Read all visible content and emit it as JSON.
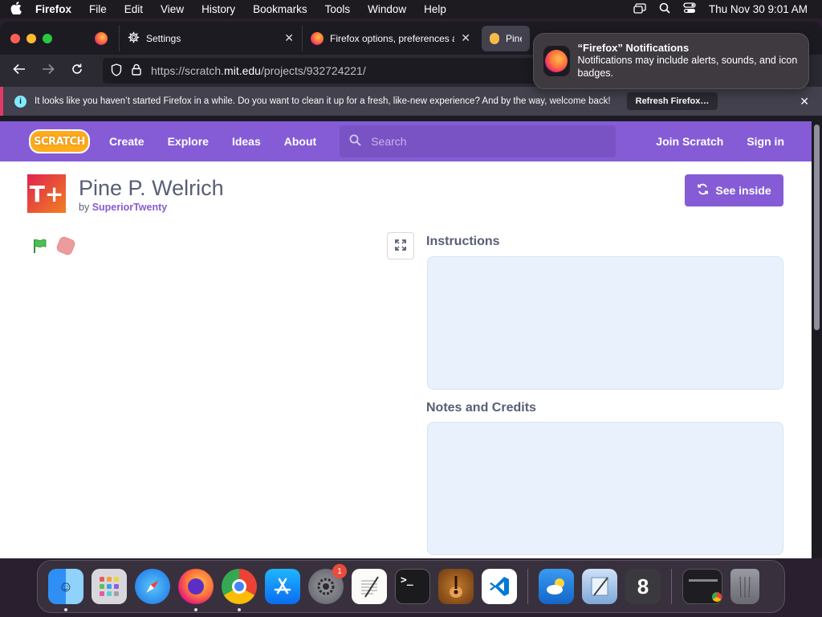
{
  "menubar": {
    "app_name": "Firefox",
    "menus": [
      "File",
      "Edit",
      "View",
      "History",
      "Bookmarks",
      "Tools",
      "Window",
      "Help"
    ],
    "clock": "Thu Nov 30  9:01 AM"
  },
  "tabs": {
    "settings": {
      "label": "Settings"
    },
    "options": {
      "label": "Firefox options, preferences and"
    },
    "active": {
      "label": "Pine P"
    }
  },
  "urlbar": {
    "prefix": "https://scratch.",
    "domain": "mit.edu",
    "path": "/projects/932724221/"
  },
  "infobar": {
    "message": "It looks like you haven’t started Firefox in a while. Do you want to clean it up for a fresh, like-new experience? And by the way, welcome back!",
    "button": "Refresh Firefox…"
  },
  "notification": {
    "title": "“Firefox” Notifications",
    "body": "Notifications may include alerts, sounds, and icon badges."
  },
  "scratch_nav": {
    "logo": "SCRATCH",
    "links": [
      "Create",
      "Explore",
      "Ideas",
      "About"
    ],
    "search_placeholder": "Search",
    "join": "Join Scratch",
    "signin": "Sign in"
  },
  "project": {
    "thumb_text": "T+",
    "title": "Pine P. Welrich",
    "by": "by",
    "author": "SuperiorTwenty",
    "see_inside": "See inside",
    "instructions_label": "Instructions",
    "notes_label": "Notes and Credits"
  },
  "dock": {
    "apps": [
      "finder-icon",
      "launchpad-icon",
      "safari-icon",
      "firefox-icon",
      "chrome-icon",
      "app-store-icon",
      "system-settings-icon",
      "textedit-icon",
      "terminal-icon",
      "garageband-icon",
      "vscode-icon",
      "weather-icon",
      "preview-icon",
      "figma-icon",
      "window-thumbnail-icon",
      "trash-icon"
    ],
    "settings_badge": "1"
  }
}
